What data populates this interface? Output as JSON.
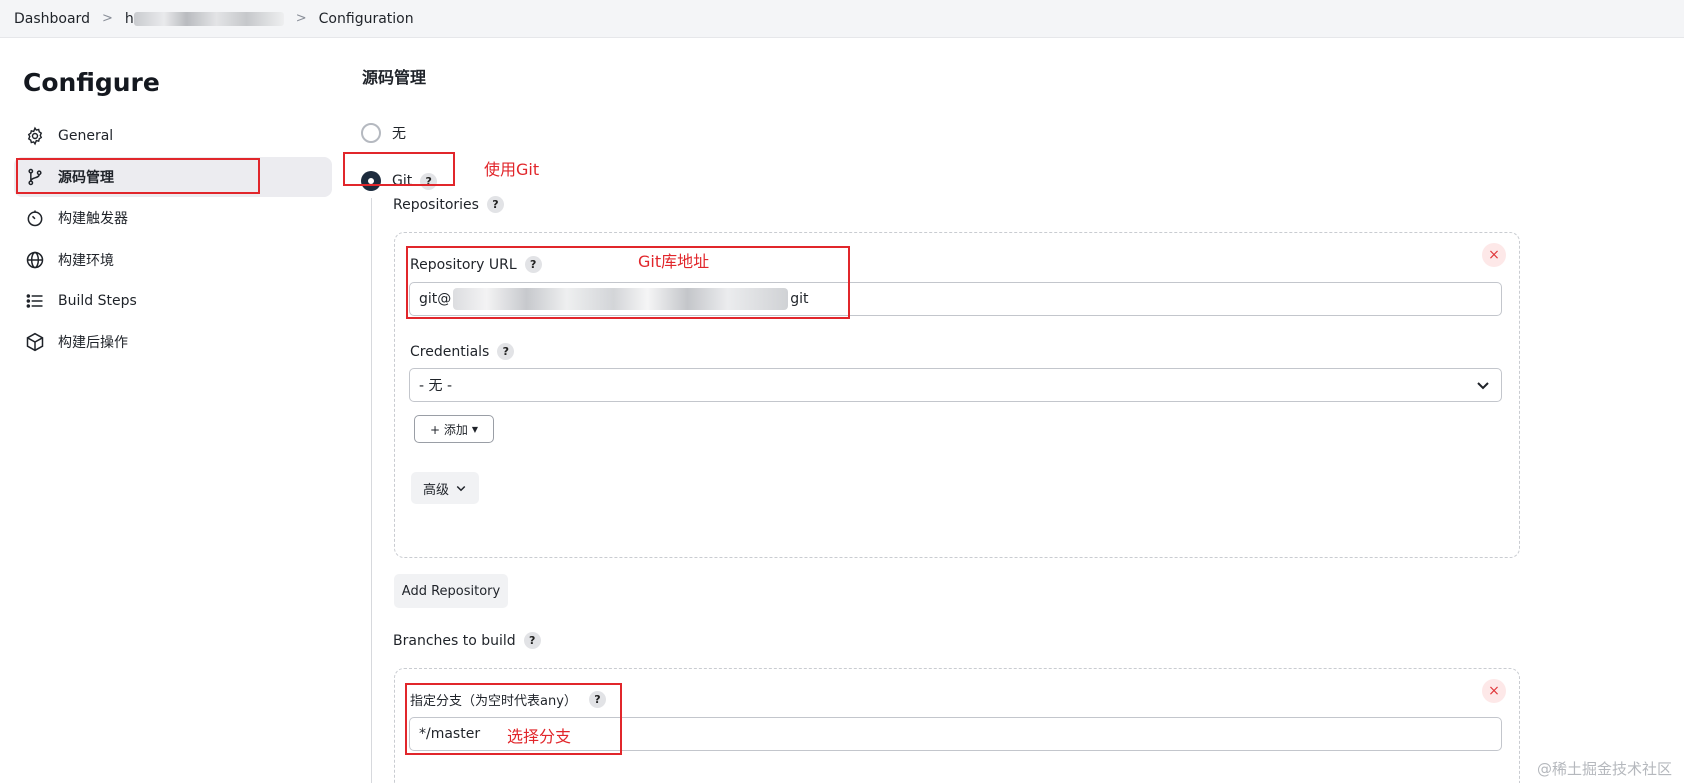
{
  "breadcrumb": {
    "items": [
      "Dashboard",
      "h",
      "Configuration"
    ],
    "separator": ">"
  },
  "sidebar": {
    "title": "Configure",
    "items": [
      {
        "label": "General",
        "icon": "gear-icon"
      },
      {
        "label": "源码管理",
        "icon": "git-branch-icon",
        "active": true
      },
      {
        "label": "构建触发器",
        "icon": "timer-icon"
      },
      {
        "label": "构建环境",
        "icon": "globe-icon"
      },
      {
        "label": "Build Steps",
        "icon": "list-icon"
      },
      {
        "label": "构建后操作",
        "icon": "package-icon"
      }
    ]
  },
  "main": {
    "section_title": "源码管理",
    "scm_options": [
      {
        "label": "无",
        "checked": false
      },
      {
        "label": "Git",
        "checked": true
      }
    ],
    "help_glyph": "?",
    "repositories_label": "Repositories",
    "repository": {
      "url_label": "Repository URL",
      "url_prefix": "git@",
      "url_suffix": "git",
      "credentials_label": "Credentials",
      "credentials_value": "- 无 -",
      "add_button": "+ 添加",
      "advanced_button": "高级",
      "remove_glyph": "×"
    },
    "add_repository_button": "Add Repository",
    "branches_label": "Branches to build",
    "branch": {
      "specifier_label": "指定分支（为空时代表any）",
      "specifier_value": "*/master",
      "remove_glyph": "×"
    }
  },
  "annotations": {
    "git": "使用Git",
    "repo_url": "Git库地址",
    "branch": "选择分支"
  },
  "watermark": "@稀土掘金技术社区",
  "colors": {
    "annotation_red": "#e1262b",
    "radio_checked": "#1d2b3d",
    "active_item_bg": "#ececf0"
  }
}
